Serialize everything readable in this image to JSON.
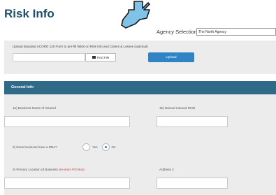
{
  "page": {
    "title": "Risk Info"
  },
  "agency": {
    "label": "Agency Selection",
    "selected": "The North Agency"
  },
  "upload": {
    "instructions": "Upload standard ACORD 130 Form to pre-fill fields on Risk Info and Claims & Losses (optional)",
    "file_value": "",
    "find_file_label": "Find File",
    "upload_label": "Upload"
  },
  "general_info": {
    "header": "General Info",
    "business_name_label": "1a) Business Name of Insured",
    "business_name_value": "",
    "fein_label": "1b) Named Insured FEIN",
    "fein_value": "",
    "dba_label": "2) Does business have a DBA?",
    "dba_yes": "Yes",
    "dba_no": "No",
    "dba_selected": "No",
    "location_label_prefix": "3) Primary Location of Business",
    "location_label_note": "(In-vitum PO Box)",
    "location_value": "",
    "address2_label": "Address 2",
    "address2_value": ""
  },
  "colors": {
    "title": "#1f4f6e",
    "section_header": "#2f6b88",
    "upload_button": "#2f84c4",
    "arrow": "#7fc3e8"
  }
}
